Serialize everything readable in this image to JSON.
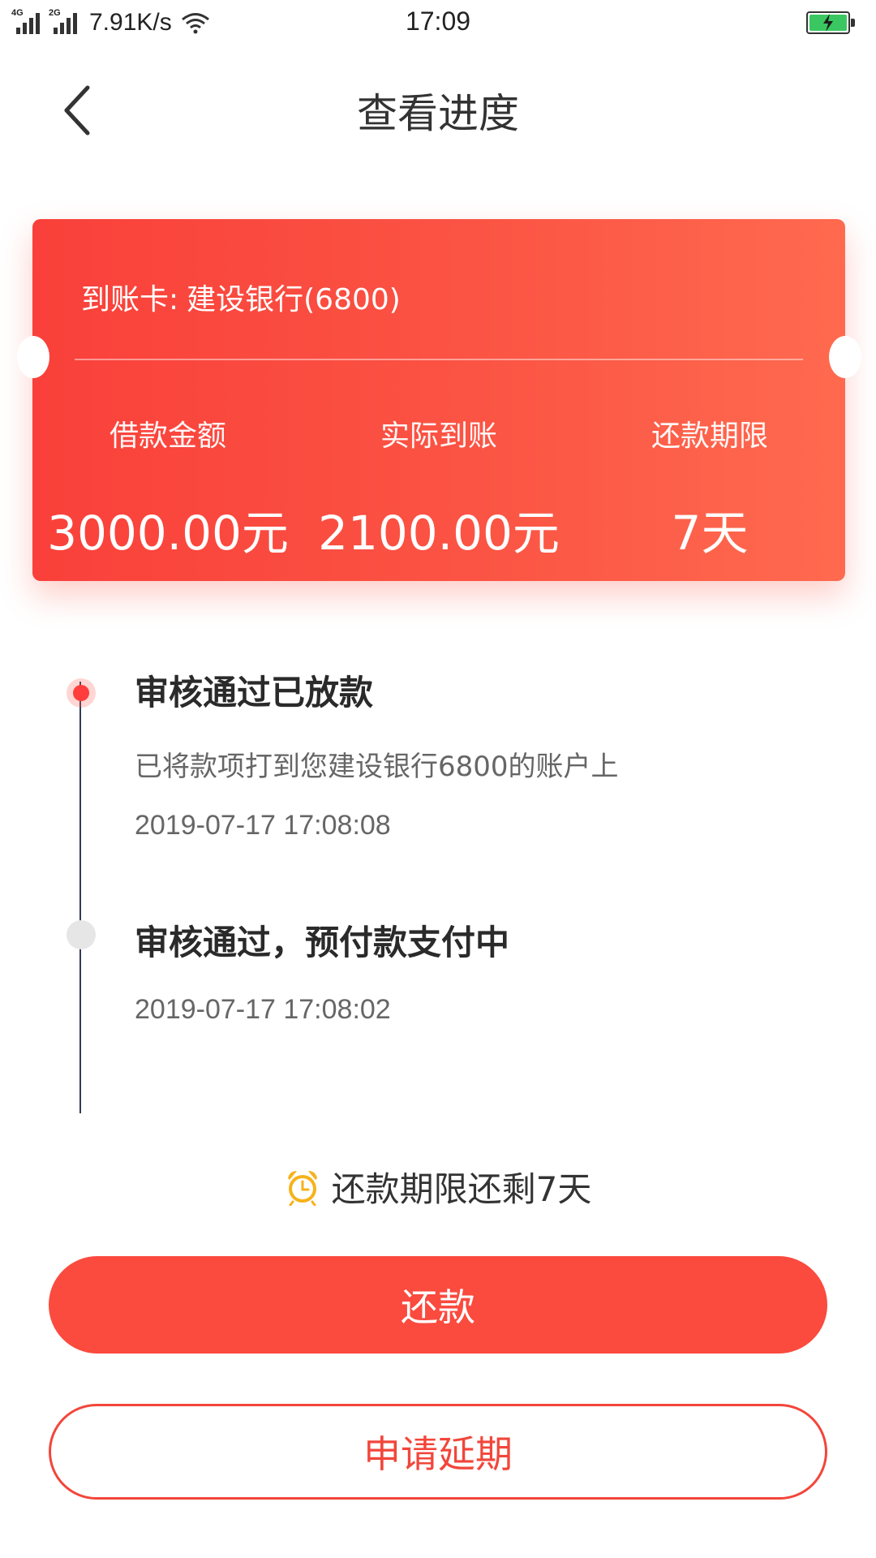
{
  "status_bar": {
    "network_1": "4G",
    "network_2": "2G",
    "speed": "7.91K/s",
    "time": "17:09",
    "battery_color": "#3ac761"
  },
  "header": {
    "title": "查看进度",
    "back_icon": "chevron-left-icon"
  },
  "card": {
    "account_label": "到账卡:",
    "account_value": "建设银行(6800)",
    "stats": [
      {
        "label": "借款金额",
        "value": "3000.00元"
      },
      {
        "label": "实际到账",
        "value": "2100.00元"
      },
      {
        "label": "还款期限",
        "value": "7天"
      }
    ],
    "gradient_start": "#f9403a",
    "gradient_end": "#ff6a4f"
  },
  "timeline": {
    "steps": [
      {
        "title": "审核通过已放款",
        "desc": "已将款项打到您建设银行6800的账户上",
        "time": "2019-07-17 17:08:08",
        "state": "active"
      },
      {
        "title": "审核通过，预付款支付中",
        "time": "2019-07-17 17:08:02",
        "state": "inactive"
      }
    ]
  },
  "reminder": {
    "icon": "alarm-clock-icon",
    "text": "还款期限还剩7天"
  },
  "buttons": {
    "repay_label": "还款",
    "extend_label": "申请延期",
    "accent": "#fb4a3e"
  }
}
